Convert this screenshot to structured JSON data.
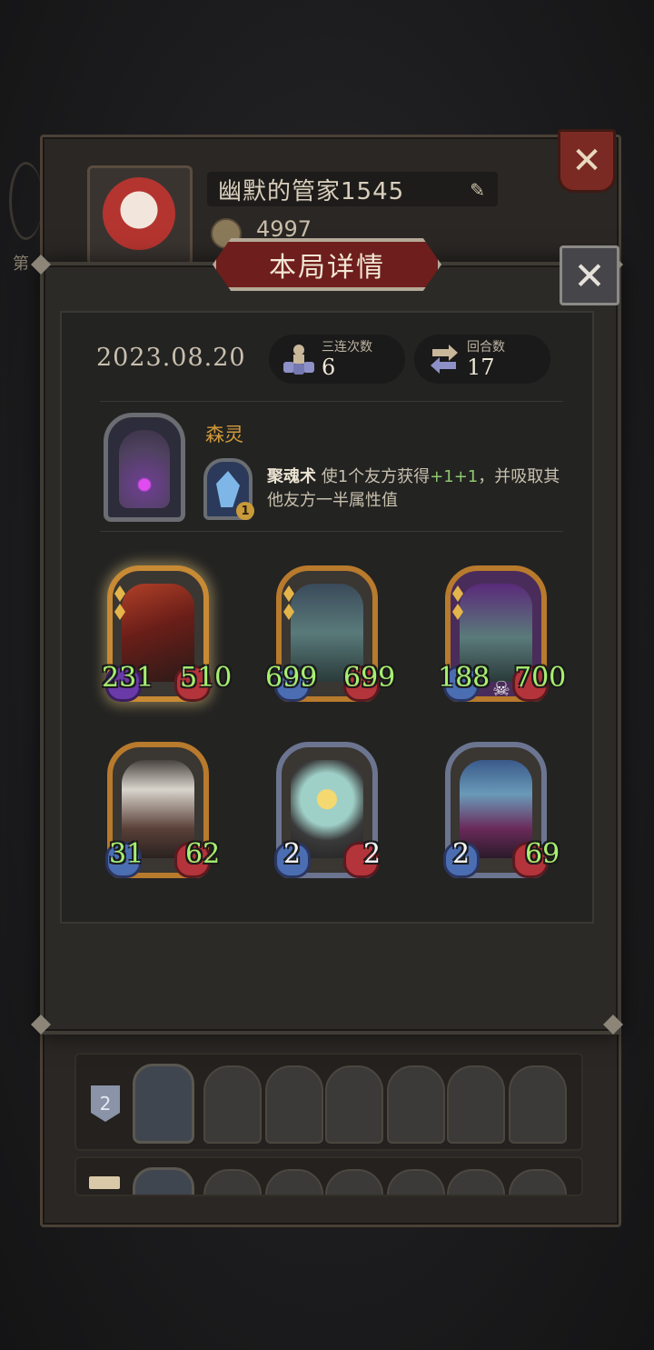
{
  "profile": {
    "player_name": "幽默的管家1545",
    "coins": "4997",
    "side_label": "第"
  },
  "dialog": {
    "title": "本局详情",
    "date": "2023.08.20",
    "triples_label": "三连次数",
    "triples_value": "6",
    "rounds_label": "回合数",
    "rounds_value": "17"
  },
  "hero": {
    "name": "森灵",
    "skill_name": "聚魂术",
    "skill_desc_a": " 使1个友方获得",
    "skill_bonus": "+1+1",
    "skill_desc_b": "，并吸取其他友方一半属性值",
    "skill_level": "1"
  },
  "units": [
    {
      "attack": "231",
      "health": "510"
    },
    {
      "attack": "699",
      "health": "699"
    },
    {
      "attack": "188",
      "health": "700"
    },
    {
      "attack": "31",
      "health": "62"
    },
    {
      "attack": "2",
      "health": "2"
    },
    {
      "attack": "2",
      "health": "69"
    }
  ],
  "history": {
    "row1_rank": "2"
  },
  "colors": {
    "stat_text": "#a7f070",
    "banner": "#6e1e1c",
    "hero_name": "#d29a3a"
  }
}
